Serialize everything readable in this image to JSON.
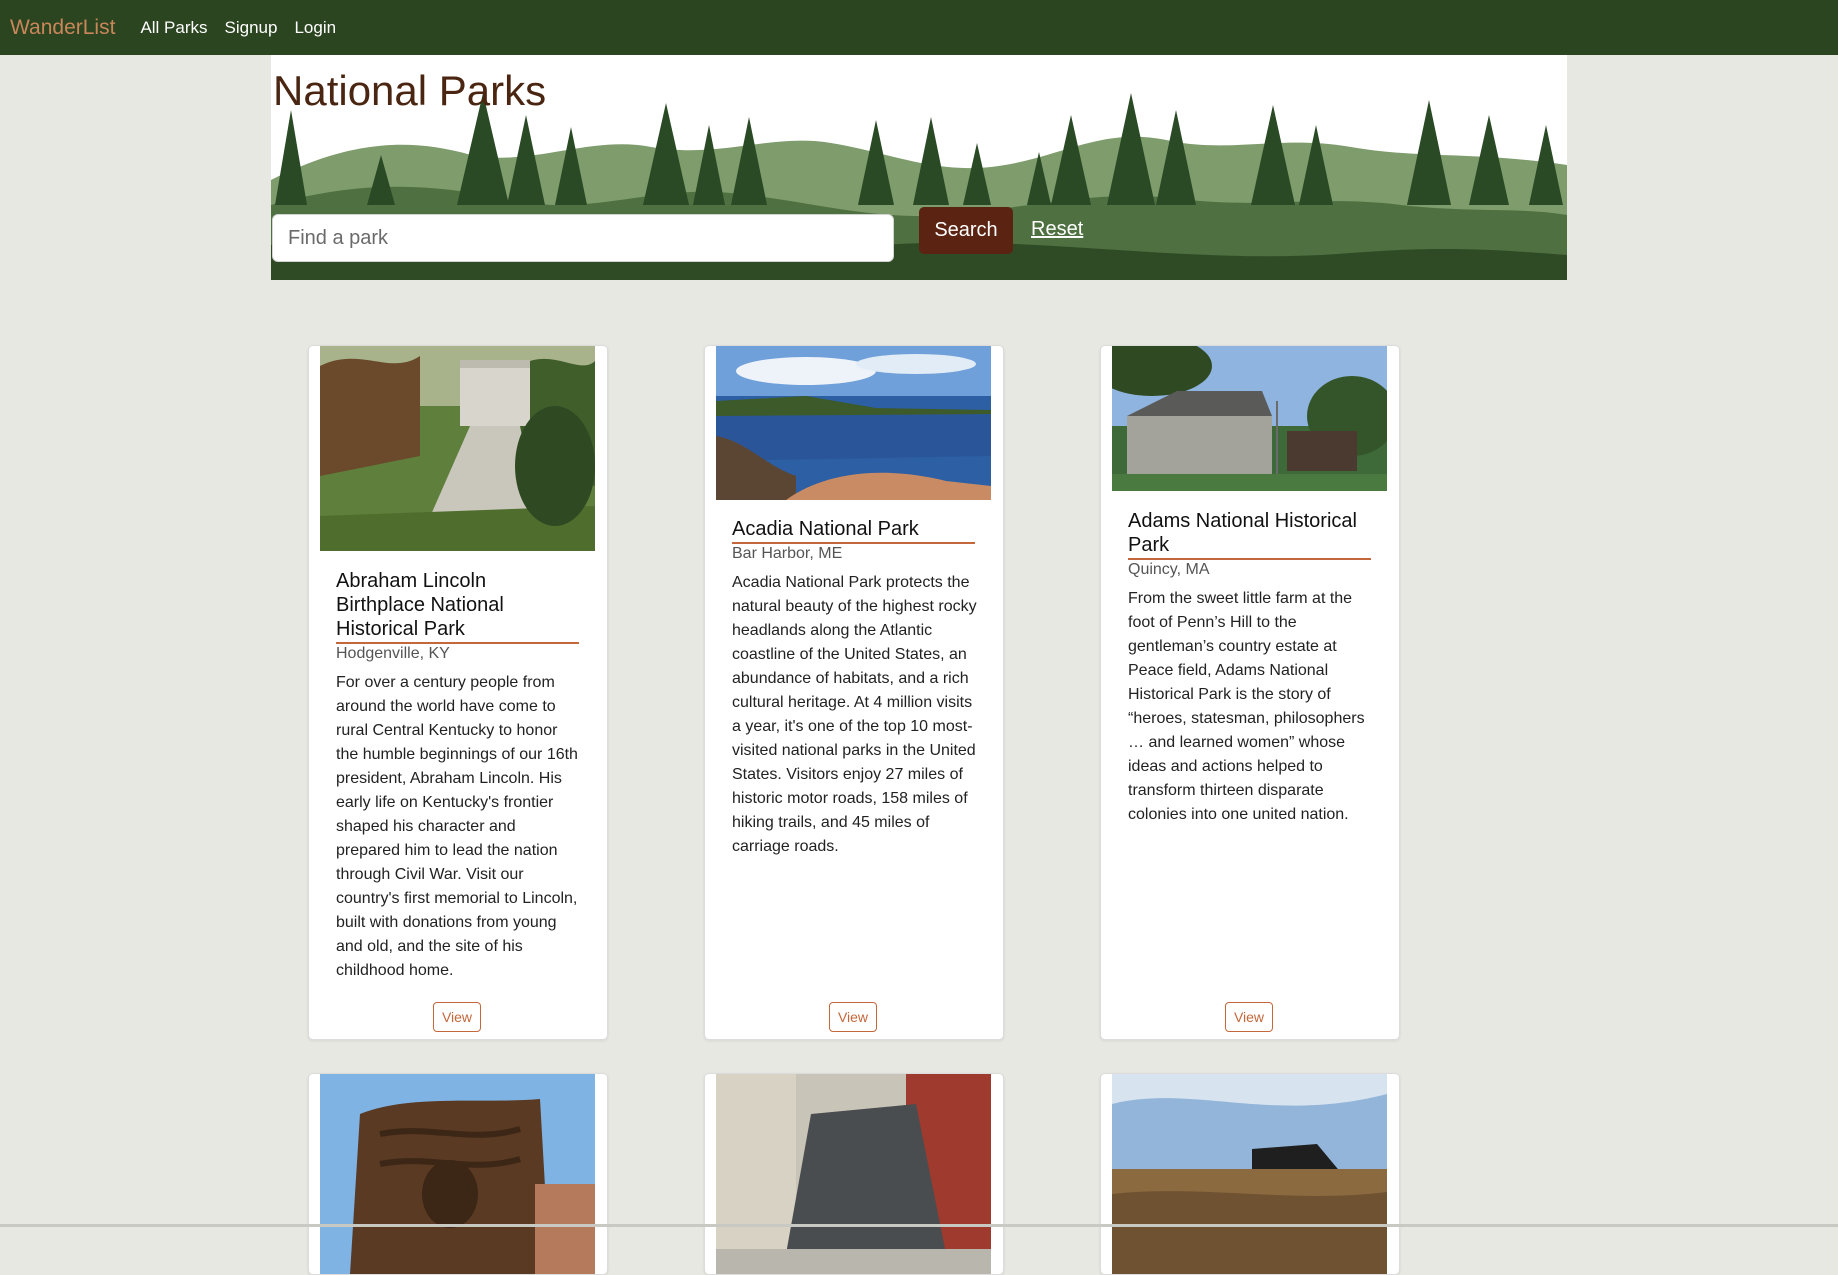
{
  "navbar": {
    "brand": "WanderList",
    "links": [
      "All Parks",
      "Signup",
      "Login"
    ]
  },
  "hero": {
    "title": "National Parks",
    "search_placeholder": "Find a park",
    "search_label": "Search",
    "reset_label": "Reset"
  },
  "parks": [
    {
      "name": "Abraham Lincoln Birthplace National Historical Park",
      "location": "Hodgenville, KY",
      "description": "For over a century people from around the world have come to rural Central Kentucky to honor the humble beginnings of our 16th president, Abraham Lincoln. His early life on Kentucky's frontier shaped his character and prepared him to lead the nation through Civil War. Visit our country's first memorial to Lincoln, built with donations from young and old, and the site of his childhood home.",
      "button": "View"
    },
    {
      "name": "Acadia National Park",
      "location": "Bar Harbor, ME",
      "description": "Acadia National Park protects the natural beauty of the highest rocky headlands along the Atlantic coastline of the United States, an abundance of habitats, and a rich cultural heritage. At 4 million visits a year, it's one of the top 10 most-visited national parks in the United States. Visitors enjoy 27 miles of historic motor roads, 158 miles of hiking trails, and 45 miles of carriage roads.",
      "button": "View"
    },
    {
      "name": "Adams National Historical Park",
      "location": "Quincy, MA",
      "description": "From the sweet little farm at the foot of Penn’s Hill to the gentleman’s country estate at Peace field, Adams National Historical Park is the story of “heroes, statesman, philosophers … and learned women” whose ideas and actions helped to transform thirteen disparate colonies into one united nation.",
      "button": "View"
    }
  ],
  "colors": {
    "navbar": "#2b4520",
    "brand": "#c9865a",
    "accent": "#c4683b",
    "search_button": "#5a2312",
    "page_background": "#e8e8e3"
  }
}
